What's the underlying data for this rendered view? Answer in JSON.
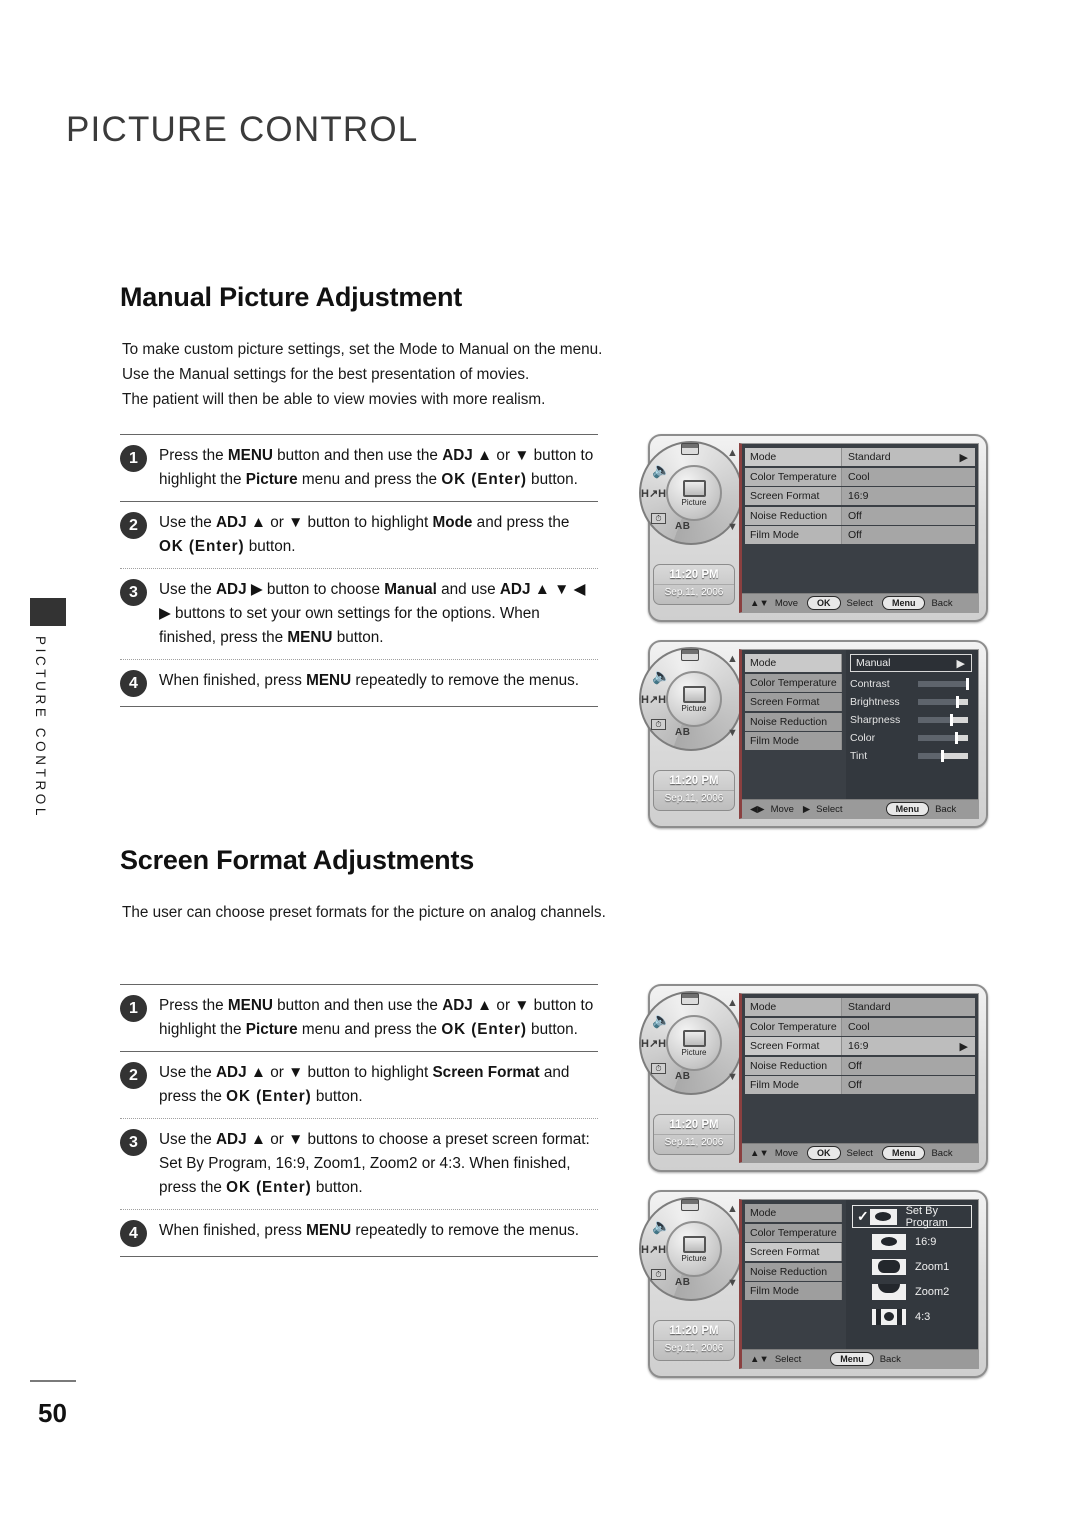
{
  "page": {
    "heading": "PICTURE CONTROL",
    "side_tab_text": "PICTURE CONTROL",
    "page_number": "50"
  },
  "sections": [
    {
      "title": "Manual Picture Adjustment",
      "intro_lines": [
        "To make custom picture settings, set the Mode to Manual on the menu.",
        "Use the Manual settings for the best presentation of movies.",
        "The patient will then be able to view movies with more realism."
      ],
      "steps": [
        {
          "num": "1",
          "html": "Press the <b>MENU</b> button and then use the <b>ADJ</b> ▲ or ▼ button to highlight the <b>Picture</b> menu and press the <b class=\"sp\">OK (Enter)</b> button."
        },
        {
          "num": "2",
          "html": "Use the <b>ADJ</b> ▲ or ▼ button to highlight <b>Mode</b> and press the <b class=\"sp\">OK (Enter)</b> button."
        },
        {
          "num": "3",
          "html": "Use the <b>ADJ</b> ▶ button to choose <b>Manual</b> and use <b>ADJ</b> ▲ ▼ ◀ ▶ buttons to set your own settings for the options. When finished, press the <b>MENU</b> button."
        },
        {
          "num": "4",
          "html": "When finished, press <b>MENU</b> repeatedly to remove the menus."
        }
      ]
    },
    {
      "title": "Screen Format Adjustments",
      "intro_lines": [
        "The user can choose preset formats for the picture on analog channels."
      ],
      "steps": [
        {
          "num": "1",
          "html": "Press the <b>MENU</b> button and then use the <b>ADJ</b> ▲ or ▼ button to highlight the <b>Picture</b> menu and press the <b class=\"sp\">OK (Enter)</b> button."
        },
        {
          "num": "2",
          "html": "Use the <b>ADJ</b> ▲ or ▼ button to highlight <b>Screen Format</b> and press the <b class=\"sp\">OK (Enter)</b> button."
        },
        {
          "num": "3",
          "html": "Use the <b>ADJ</b> ▲ or ▼ buttons to choose a preset screen format: Set By Program, 16:9, Zoom1, Zoom2 or 4:3. When finished, press the <b class=\"sp\">OK (Enter)</b> button."
        },
        {
          "num": "4",
          "html": "When finished, press <b>MENU</b> repeatedly to remove the menus."
        }
      ]
    }
  ],
  "osd_common": {
    "clock_time": "11:20 PM",
    "clock_date": "Sep.11, 2006",
    "wheel_center_label": "Picture",
    "wheel_ab_label": "AB",
    "menu_rows": [
      {
        "label": "Mode",
        "value": "Standard"
      },
      {
        "label": "Color Temperature",
        "value": "Cool"
      },
      {
        "label": "Screen Format",
        "value": "16:9"
      },
      {
        "label": "Noise Reduction",
        "value": "Off"
      },
      {
        "label": "Film Mode",
        "value": "Off"
      }
    ]
  },
  "osd_panels": [
    {
      "id": "picture-menu-standard",
      "selected_row_index": 0,
      "footer": [
        {
          "arrows": "▲▼",
          "label": "Move"
        },
        {
          "pill": "OK",
          "label": "Select"
        },
        {
          "pill": "Menu",
          "label": "Back"
        }
      ]
    },
    {
      "id": "picture-menu-manual",
      "mode_value": "Manual",
      "sliders": [
        {
          "label": "Contrast",
          "percent": 100
        },
        {
          "label": "Brightness",
          "percent": 80
        },
        {
          "label": "Sharpness",
          "percent": 68
        },
        {
          "label": "Color",
          "percent": 78
        },
        {
          "label": "Tint",
          "percent": 50
        }
      ],
      "footer": [
        {
          "arrows": "◀▶",
          "label": "Move"
        },
        {
          "arrows": "▶",
          "label": "Select"
        },
        {
          "pill": "Menu",
          "label": "Back"
        }
      ]
    },
    {
      "id": "picture-menu-screen-format",
      "selected_row_index": 2,
      "footer": [
        {
          "arrows": "▲▼",
          "label": "Move"
        },
        {
          "pill": "OK",
          "label": "Select"
        },
        {
          "pill": "Menu",
          "label": "Back"
        }
      ]
    },
    {
      "id": "screen-format-options",
      "options": [
        {
          "label": "Set By Program",
          "checked": true,
          "icon": "aspect-169"
        },
        {
          "label": "16:9",
          "checked": false,
          "icon": "aspect-169"
        },
        {
          "label": "Zoom1",
          "checked": false,
          "icon": "aspect-zoom1"
        },
        {
          "label": "Zoom2",
          "checked": false,
          "icon": "aspect-zoom2"
        },
        {
          "label": "4:3",
          "checked": false,
          "icon": "aspect-43"
        }
      ],
      "footer": [
        {
          "arrows": "▲▼",
          "label": "Select"
        },
        {
          "pill": "Menu",
          "label": "Back"
        }
      ]
    }
  ]
}
